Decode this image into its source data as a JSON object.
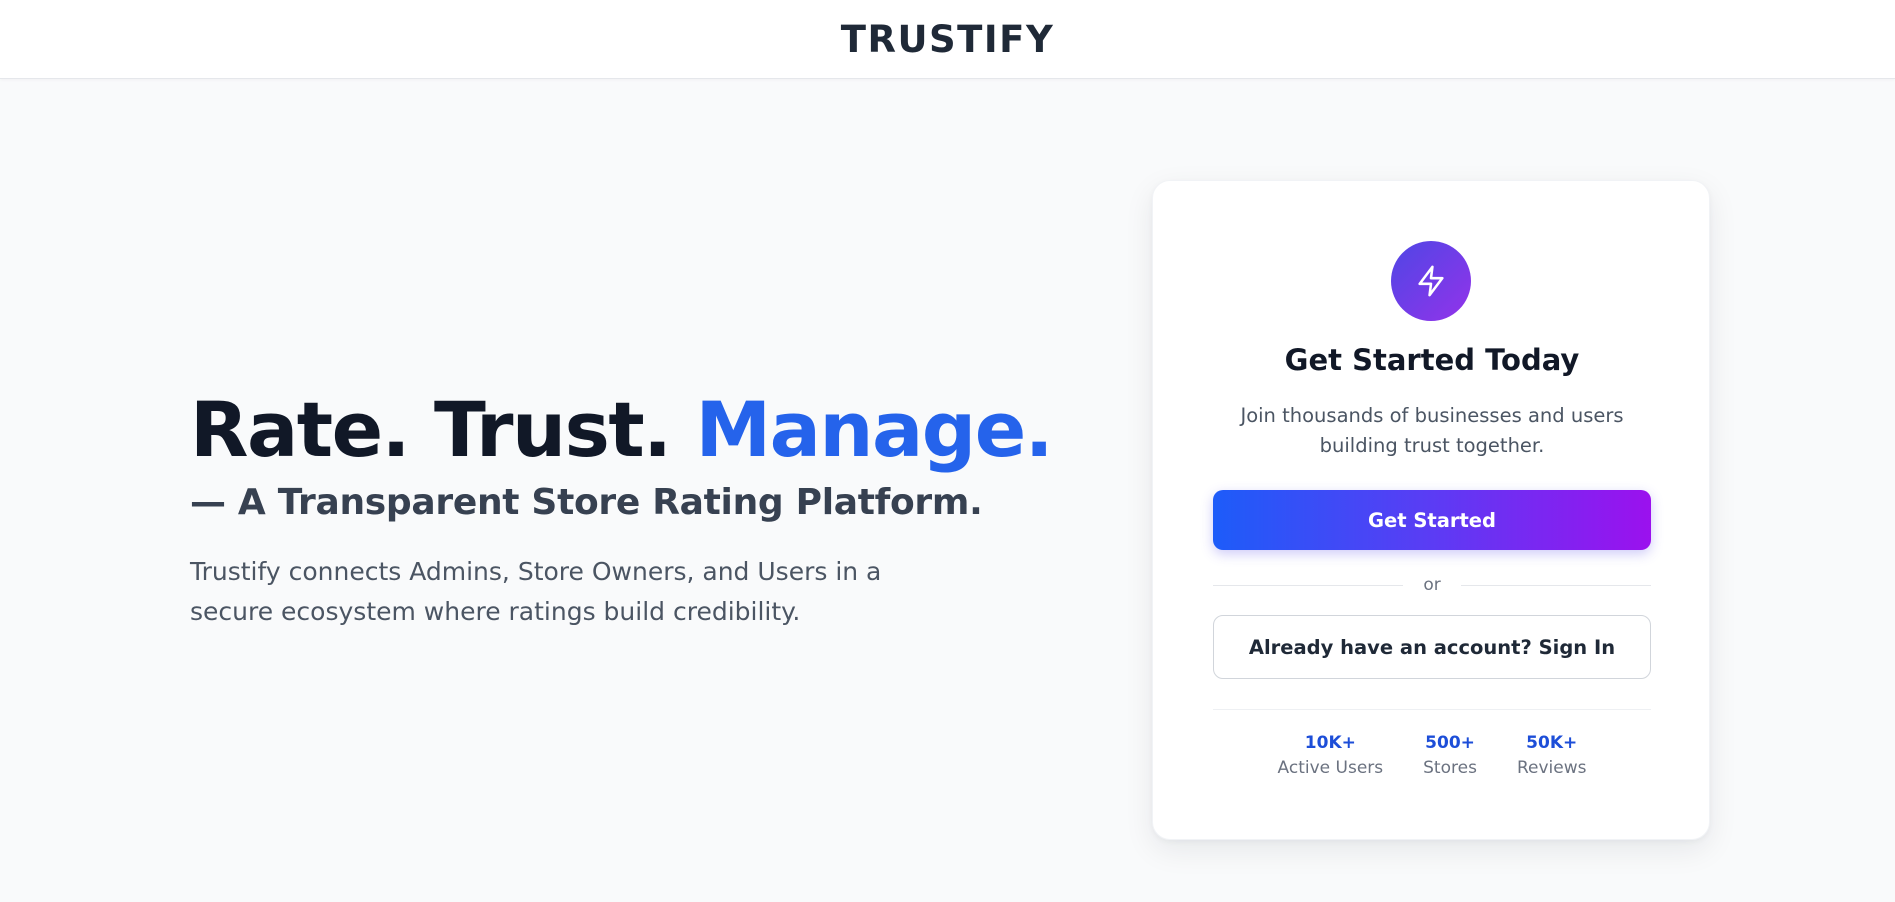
{
  "header": {
    "brand": "TRUSTIFY"
  },
  "hero": {
    "title_part1": "Rate. Trust. ",
    "title_accent": "Manage.",
    "subtitle": "— A Transparent Store Rating Platform.",
    "description": "Trustify connects Admins, Store Owners, and Users in a secure ecosystem where ratings build credibility."
  },
  "card": {
    "icon": "lightning-bolt-icon",
    "title": "Get Started Today",
    "description": "Join thousands of businesses and users building trust together.",
    "primary_button": "Get Started",
    "divider_text": "or",
    "secondary_button": "Already have an account? Sign In",
    "stats": [
      {
        "value": "10K+",
        "label": "Active Users"
      },
      {
        "value": "500+",
        "label": "Stores"
      },
      {
        "value": "50K+",
        "label": "Reviews"
      }
    ]
  },
  "colors": {
    "accent": "#2563eb",
    "gradient_start": "#1d5cf9",
    "gradient_end": "#9b11ee",
    "background": "#f9fafb"
  }
}
